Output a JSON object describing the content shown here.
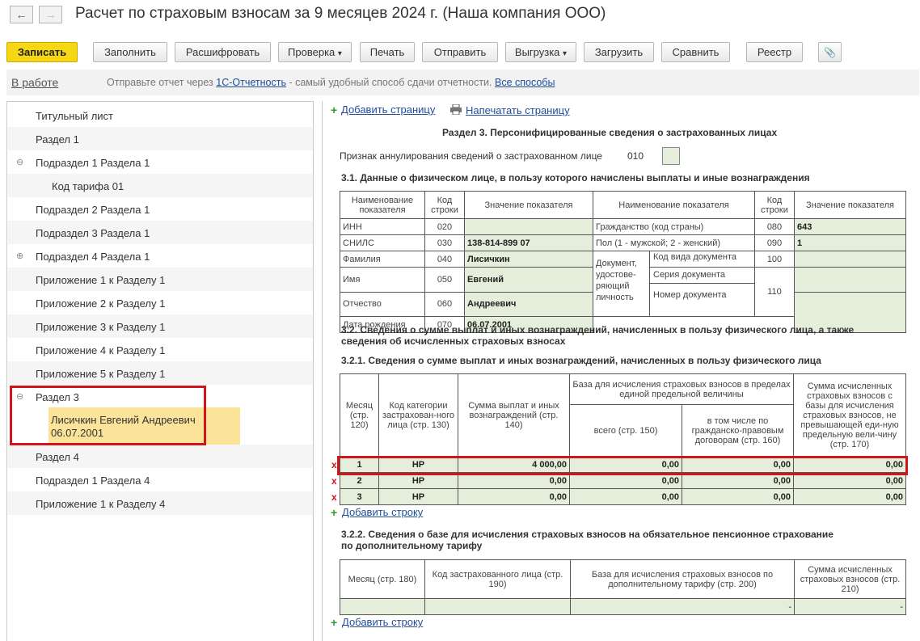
{
  "header": {
    "title": "Расчет по страховым взносам за 9 месяцев 2024 г. (Наша компания ООО)",
    "back_icon": "←",
    "forward_icon": "→"
  },
  "toolbar": {
    "save": "Записать",
    "fill": "Заполнить",
    "decode": "Расшифровать",
    "check": "Проверка",
    "print": "Печать",
    "send": "Отправить",
    "export": "Выгрузка",
    "load": "Загрузить",
    "compare": "Сравнить",
    "registry": "Реестр",
    "dropdown_arrow": "▾",
    "clip_icon": "📎"
  },
  "infobar": {
    "status": "В работе",
    "msg_prefix": "Отправьте отчет через ",
    "msg_link": "1С-Отчетность",
    "msg_suffix": " - самый удобный способ сдачи отчетности. ",
    "all_ways": "Все способы"
  },
  "tree": {
    "items": [
      "Титульный лист",
      "Раздел 1",
      "Подраздел 1 Раздела 1",
      "Код тарифа 01",
      "Подраздел 2 Раздела 1",
      "Подраздел 3 Раздела 1",
      "Подраздел 4 Раздела 1",
      "Приложение 1 к Разделу 1",
      "Приложение 2 к Разделу 1",
      "Приложение 3 к Разделу 1",
      "Приложение 4 к Разделу 1",
      "Приложение 5 к Разделу 1",
      "Раздел 3",
      "Раздел 4",
      "Подраздел 1 Раздела 4",
      "Приложение 1 к Разделу 4"
    ],
    "collapse_icon": "⊖",
    "expand_icon": "⊕",
    "selected_name": "Лисичкин Евгений Андреевич",
    "selected_date": "06.07.2001"
  },
  "right": {
    "add_page": "Добавить страницу",
    "print_page": "Напечатать страницу",
    "section_title": "Раздел 3. Персонифицированные сведения о застрахованных лицах",
    "annul_label": "Признак аннулирования сведений о застрахованном лице",
    "annul_code": "010",
    "s31_title": "3.1. Данные о физическом лице, в пользу которого начислены выплаты и иные вознаграждения",
    "t1_h": {
      "name": "Наименование показателя",
      "code": "Код строки",
      "value": "Значение показателя"
    },
    "t1": {
      "inn": "ИНН",
      "inn_c": "020",
      "inn_v": "",
      "snils": "СНИЛС",
      "snils_c": "030",
      "snils_v": "138-814-899 07",
      "fam": "Фамилия",
      "fam_c": "040",
      "fam_v": "Лисичкин",
      "name": "Имя",
      "name_c": "050",
      "name_v": "Евгений",
      "otch": "Отчество",
      "otch_c": "060",
      "otch_v": "Андреевич",
      "dr": "Дата рождения",
      "dr_c": "070",
      "dr_v": "06.07.2001",
      "citiz": "Гражданство (код страны)",
      "citiz_c": "080",
      "citiz_v": "643",
      "sex": "Пол (1 - мужской; 2 - женский)",
      "sex_c": "090",
      "sex_v": "1",
      "doc": "Документ, удостове-ряющий личность",
      "doc_kind": "Код вида документа",
      "doc_kind_c": "100",
      "doc_ser": "Серия документа",
      "doc_num": "Номер документа",
      "doc_c": "110"
    },
    "s32_title_1": "3.2. Сведения о сумме выплат и иных вознаграждений, начисленных в пользу физического лица, а также",
    "s32_title_2": "сведения об исчисленных страховых взносах",
    "s321_title": "3.2.1. Сведения о сумме выплат и иных вознаграждений, начисленных в пользу физического лица",
    "t2_h": {
      "month": "Месяц (стр. 120)",
      "cat": "Код категории застрахован-ного лица (стр. 130)",
      "sum": "Сумма выплат и иных вознаграждений (стр. 140)",
      "base": "База для исчисления страховых взносов в пределах единой предельной величины",
      "total": "всего (стр. 150)",
      "civil": "в том числе по гражданско-правовым договорам (стр. 160)",
      "calc": "Сумма исчисленных страховых взносов с базы для исчисления страховых взносов, не превышающей еди-ную предельную вели-чину (стр. 170)"
    },
    "t2_rows": [
      {
        "m": "1",
        "cat": "НР",
        "sum": "4 000,00",
        "total": "0,00",
        "civil": "0,00",
        "calc": "0,00"
      },
      {
        "m": "2",
        "cat": "НР",
        "sum": "0,00",
        "total": "0,00",
        "civil": "0,00",
        "calc": "0,00"
      },
      {
        "m": "3",
        "cat": "НР",
        "sum": "0,00",
        "total": "0,00",
        "civil": "0,00",
        "calc": "0,00"
      }
    ],
    "del_mark": "x",
    "add_row": "Добавить строку",
    "s322_title_1": "3.2.2. Сведения о базе для исчисления страховых взносов на обязательное пенсионное страхование",
    "s322_title_2": "по дополнительному тарифу",
    "t3_h": {
      "month": "Месяц (стр. 180)",
      "code": "Код застрахованного лица (стр. 190)",
      "base": "База для исчисления страховых взносов по дополнительному тарифу (стр. 200)",
      "sum": "Сумма исчисленных страховых взносов (стр. 210)"
    },
    "t3_dash": "-"
  }
}
